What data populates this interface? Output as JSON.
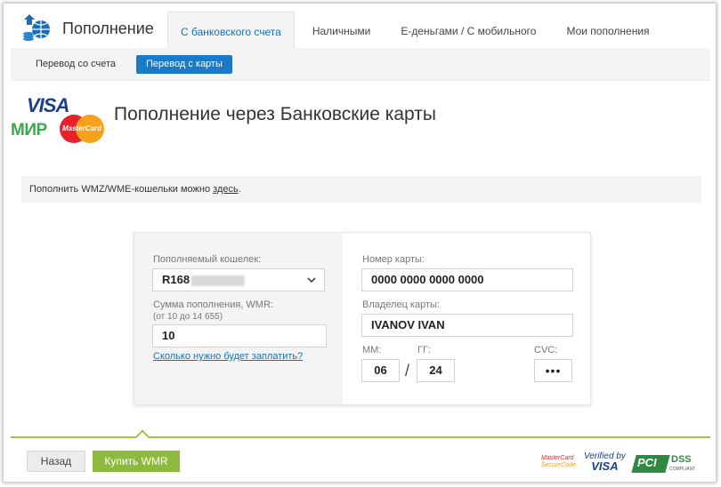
{
  "header": {
    "title": "Пополнение",
    "logo_icon": "wallet-globe-icon",
    "tabs": [
      {
        "label": "С банковского счета",
        "active": true
      },
      {
        "label": "Наличными",
        "active": false
      },
      {
        "label": "Е-деньгами / С мобильного",
        "active": false
      },
      {
        "label": "Мои пополнения",
        "active": false
      }
    ]
  },
  "subnav": {
    "items": [
      {
        "label": "Перевод со счета",
        "active": false
      },
      {
        "label": "Перевод с карты",
        "active": true
      }
    ]
  },
  "logos": {
    "visa": "VISA",
    "mir": "МИР",
    "mastercard": "MasterCard"
  },
  "page_title": "Пополнение через Банковские карты",
  "info": {
    "text": "Пополнить WMZ/WME-кошельки можно ",
    "link": "здесь",
    "suffix": "."
  },
  "form": {
    "wallet_label": "Пополняемый кошелек:",
    "wallet_value": "R168",
    "amount_label": "Сумма пополнения, WMR:",
    "amount_hint": "(от 10 до 14 655)",
    "amount_value": "10",
    "help_link": "Сколько нужно будет заплатить?",
    "card_number_label": "Номер карты:",
    "card_number_value": "0000 0000 0000 0000",
    "card_holder_label": "Владелец карты:",
    "card_holder_value": "IVANOV IVAN",
    "mm_label": "ММ:",
    "mm_value": "06",
    "yy_label": "ГГ:",
    "yy_value": "24",
    "separator": "/",
    "cvc_label": "CVC:",
    "cvc_value": "•••"
  },
  "footer": {
    "back_label": "Назад",
    "buy_label": "Купить WMR",
    "mc_secure_line1": "MasterCard",
    "mc_secure_line2": "SecureCode",
    "vbv_line1": "Verified by",
    "vbv_line2": "VISA",
    "pci": "PCI",
    "dss": "DSS",
    "dss_sub": "COMPLIANT"
  },
  "colors": {
    "accent_blue": "#1a7ac8",
    "buy_green": "#8dba3c",
    "footer_line": "#9dc24a"
  }
}
